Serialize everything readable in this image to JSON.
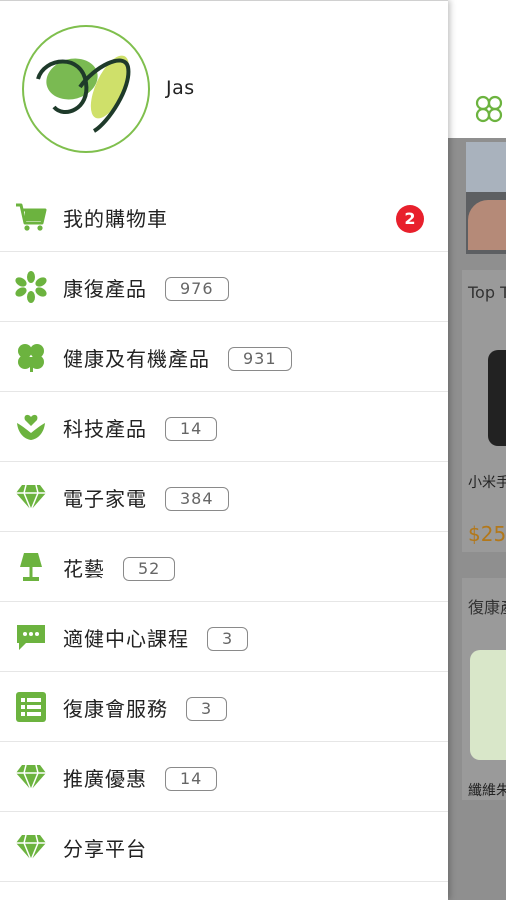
{
  "user": {
    "name": "Jas"
  },
  "cart": {
    "label": "我的購物車",
    "badge": "2"
  },
  "menu": [
    {
      "label": "康復產品",
      "count": "976",
      "icon": "asterisk-leaf-icon"
    },
    {
      "label": "健康及有機產品",
      "count": "931",
      "icon": "clover-icon"
    },
    {
      "label": "科技產品",
      "count": "14",
      "icon": "heart-hands-icon"
    },
    {
      "label": "電子家電",
      "count": "384",
      "icon": "diamond-icon"
    },
    {
      "label": "花藝",
      "count": "52",
      "icon": "lamp-icon"
    },
    {
      "label": "適健中心課程",
      "count": "3",
      "icon": "chat-icon"
    },
    {
      "label": "復康會服務",
      "count": "3",
      "icon": "list-icon"
    },
    {
      "label": "推廣優惠",
      "count": "14",
      "icon": "diamond-icon"
    },
    {
      "label": "分享平台",
      "icon": "diamond-icon"
    }
  ],
  "background": {
    "section1_title": "Top T",
    "product1_name": "小米手",
    "product1_price": "$25",
    "section2_title": "復康產",
    "product2_name": "纖維朱"
  },
  "colors": {
    "accent": "#6cb33f",
    "badge": "#e8202c"
  }
}
